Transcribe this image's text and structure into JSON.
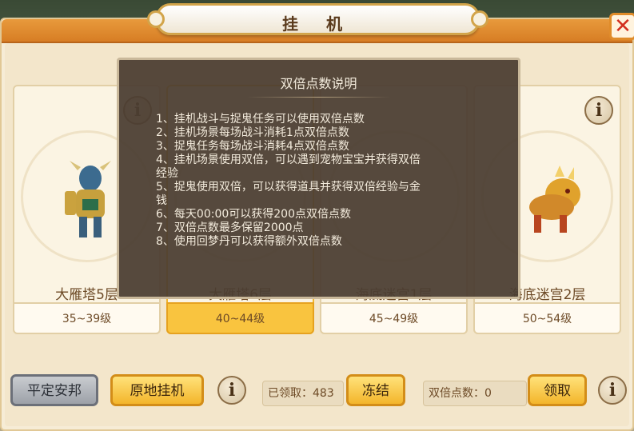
{
  "window": {
    "title": "挂 机",
    "close_icon": "close-icon"
  },
  "cards": [
    {
      "name": "大雁塔5层",
      "levels": "35~39级",
      "selected": false
    },
    {
      "name": "大雁塔6层",
      "levels": "40~44级",
      "selected": true
    },
    {
      "name": "海底迷宫1层",
      "levels": "45~49级",
      "selected": false
    },
    {
      "name": "海底迷宫2层",
      "levels": "50~54级",
      "selected": false
    }
  ],
  "dialog": {
    "title": "双倍点数说明",
    "lines": [
      "1、挂机战斗与捉鬼任务可以使用双倍点数",
      "2、挂机场景每场战斗消耗1点双倍点数",
      "3、捉鬼任务每场战斗消耗4点双倍点数",
      "4、挂机场景使用双倍，可以遇到宠物宝宝并获得双倍",
      "经验",
      "5、捉鬼使用双倍，可以获得道具并获得双倍经验与金",
      "钱",
      "6、每天00:00可以获得200点双倍点数",
      "7、双倍点数最多保留2000点",
      "8、使用回梦丹可以获得额外双倍点数"
    ]
  },
  "bottom": {
    "pingding_label": "平定安邦",
    "yuandi_label": "原地挂机",
    "received_label": "已领取：483",
    "freeze_label": "冻结",
    "double_points_label": "双倍点数：0",
    "claim_label": "领取",
    "info_glyph": "i"
  },
  "colors": {
    "accent_orange": "#e08c2a",
    "button_yellow": "#f3b52b",
    "close_red": "#d22e1f"
  }
}
